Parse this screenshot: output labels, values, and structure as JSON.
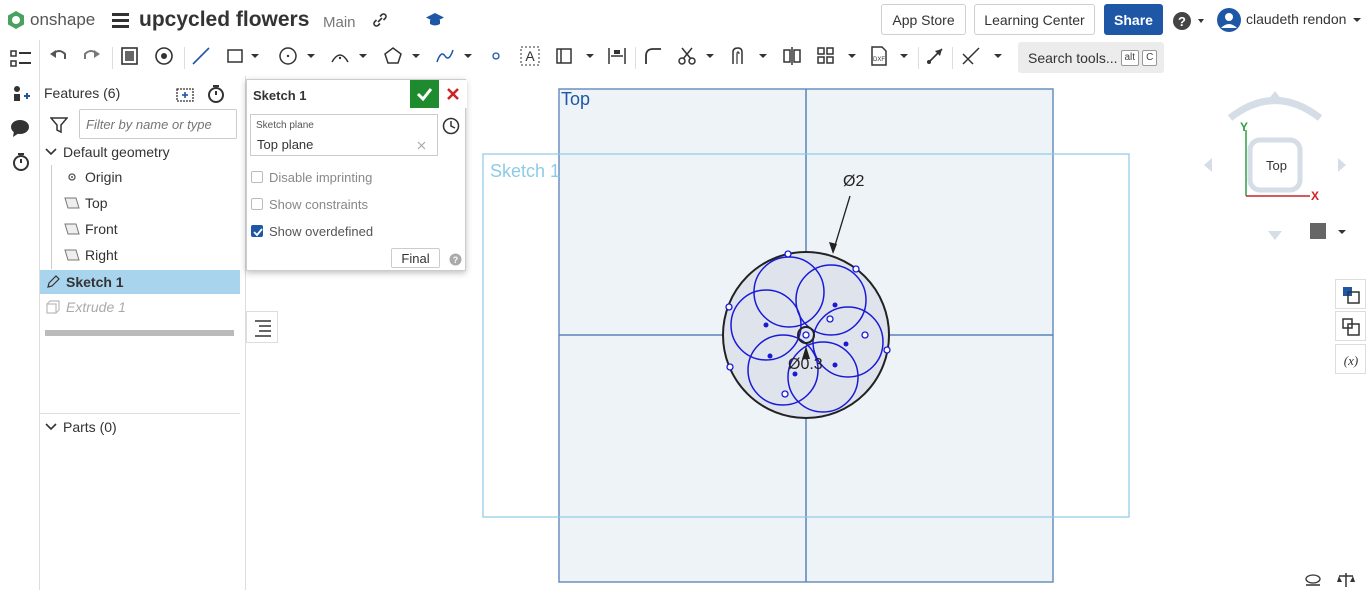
{
  "app": {
    "logo_text": "onshape",
    "doc_title": "upcycled flowers",
    "branch": "Main"
  },
  "header": {
    "app_store_label": "App Store",
    "learning_center_label": "Learning Center",
    "share_label": "Share",
    "user_name": "claudeth rendon"
  },
  "toolbar": {
    "search_label": "Search tools...",
    "search_shortcut_1": "alt",
    "search_shortcut_2": "C"
  },
  "feature_panel": {
    "title": "Features (6)",
    "filter_placeholder": "Filter by name or type",
    "default_geometry_label": "Default geometry",
    "items": [
      {
        "label": "Origin"
      },
      {
        "label": "Top"
      },
      {
        "label": "Front"
      },
      {
        "label": "Right"
      },
      {
        "label": "Sketch 1"
      },
      {
        "label": "Extrude 1"
      }
    ],
    "parts_label": "Parts (0)"
  },
  "sketch_dialog": {
    "title": "Sketch 1",
    "plane_caption": "Sketch plane",
    "plane_value": "Top plane",
    "options": [
      {
        "label": "Disable imprinting",
        "checked": false
      },
      {
        "label": "Show constraints",
        "checked": false
      },
      {
        "label": "Show overdefined",
        "checked": true
      }
    ],
    "final_label": "Final"
  },
  "viewport": {
    "plane_label": "Top",
    "sketch_label": "Sketch 1",
    "dim_outer": "Ø2",
    "dim_inner": "Ø0.3"
  },
  "view_cube": {
    "face_label": "Top",
    "axis_y": "Y",
    "axis_x": "X"
  },
  "colors": {
    "brand_blue": "#1e57a6",
    "ok_green": "#1e8c2e",
    "sketch_blue": "#1a1ad6",
    "plane_fill": "#eef3f8",
    "plane_stroke": "#6a8fbf",
    "sketch_frame": "#8ccbe6",
    "selected_row": "#a9d4ee"
  }
}
